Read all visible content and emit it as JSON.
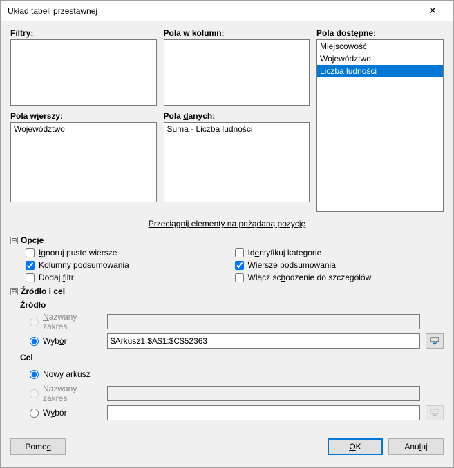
{
  "window": {
    "title": "Układ tabeli przestawnej"
  },
  "labels": {
    "filters": "Filtry:",
    "column_fields": "Pola w kolumn:",
    "available_fields": "Pola dostępne:",
    "row_fields": "Pola wierszy:",
    "data_fields": "Pola danych:",
    "hint": "Przeciągnij elementy na pożądaną pozycję",
    "options": "Opcje",
    "source_target": "Źródło i cel",
    "source": "Źródło",
    "target": "Cel"
  },
  "available": {
    "items": [
      "Miejscowość",
      "Województwo",
      "Liczba ludności"
    ],
    "selected_index": 2
  },
  "row_fields": {
    "items": [
      "Województwo"
    ]
  },
  "data_fields": {
    "items": [
      "Suma - Liczba ludności"
    ]
  },
  "options": {
    "ignore_empty_rows": {
      "label": "Ignoruj puste wiersze",
      "ul": "I",
      "checked": false
    },
    "total_columns": {
      "label": "Kolumny podsumowania",
      "ul": "K",
      "checked": true
    },
    "add_filter": {
      "label": "Dodaj filtr",
      "ul": "f",
      "checked": false
    },
    "identify_categories": {
      "label": "Identyfikuj kategorie",
      "ul": "e",
      "checked": false
    },
    "total_rows": {
      "label": "Wiersze podsumowania",
      "ul": "z",
      "checked": true
    },
    "enable_drilldown": {
      "label": "Włącz schodzenie do szczegółów",
      "ul": "h",
      "checked": false
    }
  },
  "source": {
    "named_range": {
      "label": "Nazwany zakres",
      "ul": "N",
      "selected": false,
      "value": "",
      "disabled": true
    },
    "selection": {
      "label": "Wybór",
      "ul": "ó",
      "selected": true,
      "value": "$Arkusz1.$A$1:$C$52363"
    }
  },
  "target": {
    "new_sheet": {
      "label": "Nowy arkusz",
      "ul": "a",
      "selected": true
    },
    "named_range": {
      "label": "Nazwany zakres",
      "ul": "s",
      "selected": false,
      "value": "",
      "disabled": true
    },
    "selection": {
      "label": "Wybór",
      "ul": "y",
      "selected": false,
      "value": ""
    }
  },
  "buttons": {
    "help": "Pomoc",
    "ok": "OK",
    "cancel": "Anuluj"
  }
}
